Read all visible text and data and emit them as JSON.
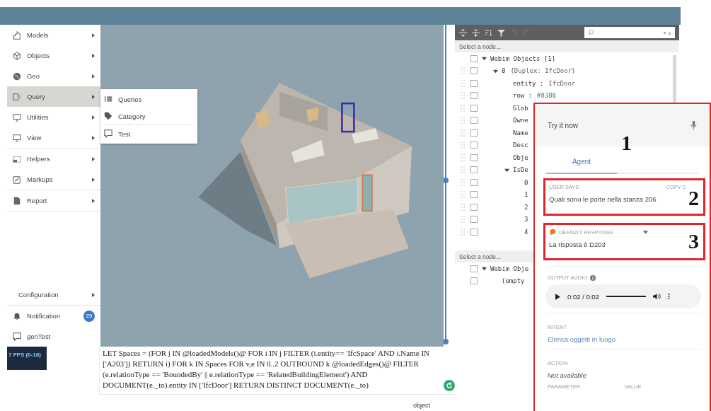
{
  "sidebar": {
    "groups": [
      [
        {
          "label": "Models",
          "selected": false
        },
        {
          "label": "Objects",
          "selected": false
        },
        {
          "label": "Geo",
          "selected": false
        },
        {
          "label": "Query",
          "selected": true
        },
        {
          "label": "Utilities",
          "selected": false
        },
        {
          "label": "View",
          "selected": false
        }
      ],
      [
        {
          "label": "Helpers",
          "selected": false
        },
        {
          "label": "Markups",
          "selected": false
        }
      ],
      [
        {
          "label": "Report",
          "selected": false
        }
      ]
    ],
    "configuration": {
      "label": "Configuration",
      "selected": false
    },
    "footer": [
      {
        "label": "Notification",
        "badge": "25"
      },
      {
        "label": "genTest"
      }
    ]
  },
  "submenu": {
    "groups": [
      [
        {
          "label": "Queries"
        },
        {
          "label": "Category"
        }
      ],
      [
        {
          "label": "Test"
        }
      ]
    ]
  },
  "query_text": "LET Spaces = (FOR j IN @loadedModels()@ FOR i IN j FILTER (i.entity== 'IfcSpace' AND i.Name IN ['A203']) RETURN i) FOR k IN Spaces FOR v,e IN 0..2 OUTBOUND k @loadedEdges()@ FILTER (e.relationType == 'BoundedBy' || e.relationType == 'RelatedBuildingElement') AND DOCUMENT(e._to).entity IN ['IfcDoor'] RETURN DISTINCT DOCUMENT(e._to)",
  "stats": {
    "label": "7 FPS (0-18)"
  },
  "status_text": "object",
  "tree_panel": {
    "search_arrows": "▼▲",
    "top_tree": {
      "header": "Select a node...",
      "nodes": [
        {
          "label": "Webim Objects [1]",
          "checked": false,
          "expanded": true,
          "children": [
            {
              "label": "0",
              "value": "{Duplex: IfcDoor}",
              "checked": false,
              "expanded": true,
              "children": [
                {
                  "label": "entity :",
                  "value": "IfcDoor",
                  "checked": false
                },
                {
                  "label": "row  :",
                  "value": "#8386",
                  "checked": false
                },
                {
                  "label": "Glob",
                  "checked": false
                },
                {
                  "label": "Owne",
                  "checked": false
                },
                {
                  "label": "Name",
                  "checked": false
                },
                {
                  "label": "Desc",
                  "checked": false
                },
                {
                  "label": "Obje",
                  "checked": false
                },
                {
                  "label": "IsDe",
                  "checked": false,
                  "expanded": true,
                  "children": [
                    {
                      "label": "0",
                      "checked": false
                    },
                    {
                      "label": "1",
                      "checked": false
                    },
                    {
                      "label": "2",
                      "checked": false
                    },
                    {
                      "label": "3",
                      "checked": false
                    },
                    {
                      "label": "4",
                      "checked": false
                    }
                  ]
                }
              ]
            }
          ]
        }
      ]
    },
    "bottom_tree": {
      "header": "Select a node...",
      "nodes": [
        {
          "label": "Webim Obje",
          "checked": false,
          "expanded": true,
          "children": [
            {
              "label": "(empty",
              "checked": false
            }
          ]
        }
      ]
    }
  },
  "dialog": {
    "title": "Try it now",
    "tabs": [
      {
        "label": "Agent",
        "selected": true
      }
    ],
    "user_says": {
      "label": "USER SAYS",
      "action": "COPY C",
      "text": "Quali sono le porte nella stanza 206"
    },
    "response": {
      "label": "DEFAULT RESPONSE",
      "text": "La risposta è D203"
    },
    "output_audio": {
      "label": "OUTPUT AUDIO",
      "time": "0:02 / 0:02",
      "level": 1
    },
    "intent": {
      "label": "INTENT",
      "text": "Elenca oggetti in luogo"
    },
    "action": {
      "label": "ACTION",
      "text": "Not available"
    },
    "parameter_columns": [
      "PARAMETER",
      "VALUE"
    ]
  },
  "annotations": [
    {
      "label": "1"
    },
    {
      "label": "2"
    },
    {
      "label": "3"
    }
  ]
}
